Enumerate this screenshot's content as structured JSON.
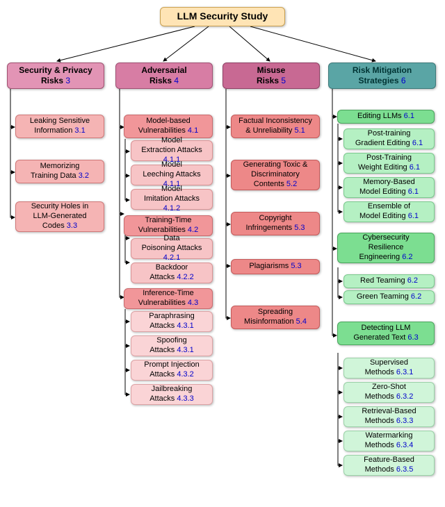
{
  "root": {
    "title": "LLM Security Study"
  },
  "cats": {
    "sec": {
      "label": "Security & Privacy\nRisks",
      "ref": "3"
    },
    "adv": {
      "label": "Adversarial\nRisks",
      "ref": "4"
    },
    "mis": {
      "label": "Misuse\nRisks",
      "ref": "5"
    },
    "mit": {
      "label": "Risk Mitigation\nStrategies",
      "ref": "6"
    }
  },
  "sec_items": {
    "a": {
      "label": "Leaking Sensitive\nInformation",
      "ref": "3.1"
    },
    "b": {
      "label": "Memorizing\nTraining Data",
      "ref": "3.2"
    },
    "c": {
      "label": "Security Holes in\nLLM-Generated\nCodes",
      "ref": "3.3"
    }
  },
  "adv_items": {
    "mbv": {
      "label": "Model-based\nVulnerabilities",
      "ref": "4.1"
    },
    "mea": {
      "label": "Model\nExtraction Attacks",
      "ref": "4.1.1"
    },
    "mla": {
      "label": "Model\nLeeching Attacks",
      "ref": "4.1.1"
    },
    "mia": {
      "label": "Model\nImitation Attacks",
      "ref": "4.1.2"
    },
    "ttv": {
      "label": "Training-Time\nVulnerabilities",
      "ref": "4.2"
    },
    "dpa": {
      "label": "Data\nPoisoning Attacks",
      "ref": "4.2.1"
    },
    "bda": {
      "label": "Backdoor\nAttacks",
      "ref": "4.2.2"
    },
    "itv": {
      "label": "Inference-Time\nVulnerabilities",
      "ref": "4.3"
    },
    "par": {
      "label": "Paraphrasing\nAttacks",
      "ref": "4.3.1"
    },
    "spo": {
      "label": "Spoofing\nAttacks",
      "ref": "4.3.1"
    },
    "pia": {
      "label": "Prompt Injection\nAttacks",
      "ref": "4.3.2"
    },
    "jba": {
      "label": "Jailbreaking\nAttacks",
      "ref": "4.3.3"
    }
  },
  "mis_items": {
    "fi": {
      "label": "Factual Inconsistency\n& Unreliability",
      "ref": "5.1"
    },
    "tx": {
      "label": "Generating Toxic &\nDiscriminatory\nContents",
      "ref": "5.2"
    },
    "cp": {
      "label": "Copyright\nInfringements",
      "ref": "5.3"
    },
    "pl": {
      "label": "Plagiarisms",
      "ref": "5.3"
    },
    "sm": {
      "label": "Spreading\nMisinformation",
      "ref": "5.4"
    }
  },
  "mit_items": {
    "ed": {
      "label": "Editing LLMs",
      "ref": "6.1"
    },
    "pge": {
      "label": "Post-training\nGradient Editing",
      "ref": "6.1"
    },
    "pwe": {
      "label": "Post-Training\nWeight Editing",
      "ref": "6.1"
    },
    "mbe": {
      "label": "Memory-Based\nModel Editing",
      "ref": "6.1"
    },
    "eme": {
      "label": "Ensemble of\nModel Editing",
      "ref": "6.1"
    },
    "cre": {
      "label": "Cybersecurity\nResilience\nEngineering",
      "ref": "6.2"
    },
    "rt": {
      "label": "Red Teaming",
      "ref": "6.2"
    },
    "gt": {
      "label": "Green Teaming",
      "ref": "6.2"
    },
    "dgt": {
      "label": "Detecting LLM\nGenerated Text",
      "ref": "6.3"
    },
    "sup": {
      "label": "Supervised\nMethods",
      "ref": "6.3.1"
    },
    "zs": {
      "label": "Zero-Shot\nMethods",
      "ref": "6.3.2"
    },
    "rb": {
      "label": "Retrieval-Based\nMethods",
      "ref": "6.3.3"
    },
    "wm": {
      "label": "Watermarking\nMethods",
      "ref": "6.3.4"
    },
    "fb": {
      "label": "Feature-Based\nMethods",
      "ref": "6.3.5"
    }
  },
  "chart_data": {
    "type": "tree",
    "title": "LLM Security Study",
    "nodes": [
      {
        "id": "root",
        "label": "LLM Security Study"
      },
      {
        "id": "sec",
        "label": "Security & Privacy Risks",
        "ref": "3",
        "parent": "root"
      },
      {
        "id": "adv",
        "label": "Adversarial Risks",
        "ref": "4",
        "parent": "root"
      },
      {
        "id": "mis",
        "label": "Misuse Risks",
        "ref": "5",
        "parent": "root"
      },
      {
        "id": "mit",
        "label": "Risk Mitigation Strategies",
        "ref": "6",
        "parent": "root"
      },
      {
        "id": "sec.a",
        "label": "Leaking Sensitive Information",
        "ref": "3.1",
        "parent": "sec"
      },
      {
        "id": "sec.b",
        "label": "Memorizing Training Data",
        "ref": "3.2",
        "parent": "sec"
      },
      {
        "id": "sec.c",
        "label": "Security Holes in LLM-Generated Codes",
        "ref": "3.3",
        "parent": "sec"
      },
      {
        "id": "adv.mbv",
        "label": "Model-based Vulnerabilities",
        "ref": "4.1",
        "parent": "adv"
      },
      {
        "id": "adv.mea",
        "label": "Model Extraction Attacks",
        "ref": "4.1.1",
        "parent": "adv.mbv"
      },
      {
        "id": "adv.mla",
        "label": "Model Leeching Attacks",
        "ref": "4.1.1",
        "parent": "adv.mbv"
      },
      {
        "id": "adv.mia",
        "label": "Model Imitation Attacks",
        "ref": "4.1.2",
        "parent": "adv.mbv"
      },
      {
        "id": "adv.ttv",
        "label": "Training-Time Vulnerabilities",
        "ref": "4.2",
        "parent": "adv"
      },
      {
        "id": "adv.dpa",
        "label": "Data Poisoning Attacks",
        "ref": "4.2.1",
        "parent": "adv.ttv"
      },
      {
        "id": "adv.bda",
        "label": "Backdoor Attacks",
        "ref": "4.2.2",
        "parent": "adv.ttv"
      },
      {
        "id": "adv.itv",
        "label": "Inference-Time Vulnerabilities",
        "ref": "4.3",
        "parent": "adv"
      },
      {
        "id": "adv.par",
        "label": "Paraphrasing Attacks",
        "ref": "4.3.1",
        "parent": "adv.itv"
      },
      {
        "id": "adv.spo",
        "label": "Spoofing Attacks",
        "ref": "4.3.1",
        "parent": "adv.itv"
      },
      {
        "id": "adv.pia",
        "label": "Prompt Injection Attacks",
        "ref": "4.3.2",
        "parent": "adv.itv"
      },
      {
        "id": "adv.jba",
        "label": "Jailbreaking Attacks",
        "ref": "4.3.3",
        "parent": "adv.itv"
      },
      {
        "id": "mis.fi",
        "label": "Factual Inconsistency & Unreliability",
        "ref": "5.1",
        "parent": "mis"
      },
      {
        "id": "mis.tx",
        "label": "Generating Toxic & Discriminatory Contents",
        "ref": "5.2",
        "parent": "mis"
      },
      {
        "id": "mis.cp",
        "label": "Copyright Infringements",
        "ref": "5.3",
        "parent": "mis"
      },
      {
        "id": "mis.pl",
        "label": "Plagiarisms",
        "ref": "5.3",
        "parent": "mis"
      },
      {
        "id": "mis.sm",
        "label": "Spreading Misinformation",
        "ref": "5.4",
        "parent": "mis"
      },
      {
        "id": "mit.ed",
        "label": "Editing LLMs",
        "ref": "6.1",
        "parent": "mit"
      },
      {
        "id": "mit.pge",
        "label": "Post-training Gradient Editing",
        "ref": "6.1",
        "parent": "mit.ed"
      },
      {
        "id": "mit.pwe",
        "label": "Post-Training Weight Editing",
        "ref": "6.1",
        "parent": "mit.ed"
      },
      {
        "id": "mit.mbe",
        "label": "Memory-Based Model Editing",
        "ref": "6.1",
        "parent": "mit.ed"
      },
      {
        "id": "mit.eme",
        "label": "Ensemble of Model Editing",
        "ref": "6.1",
        "parent": "mit.ed"
      },
      {
        "id": "mit.cre",
        "label": "Cybersecurity Resilience Engineering",
        "ref": "6.2",
        "parent": "mit"
      },
      {
        "id": "mit.rt",
        "label": "Red Teaming",
        "ref": "6.2",
        "parent": "mit.cre"
      },
      {
        "id": "mit.gt",
        "label": "Green Teaming",
        "ref": "6.2",
        "parent": "mit.cre"
      },
      {
        "id": "mit.dgt",
        "label": "Detecting LLM Generated Text",
        "ref": "6.3",
        "parent": "mit"
      },
      {
        "id": "mit.sup",
        "label": "Supervised Methods",
        "ref": "6.3.1",
        "parent": "mit.dgt"
      },
      {
        "id": "mit.zs",
        "label": "Zero-Shot Methods",
        "ref": "6.3.2",
        "parent": "mit.dgt"
      },
      {
        "id": "mit.rb",
        "label": "Retrieval-Based Methods",
        "ref": "6.3.3",
        "parent": "mit.dgt"
      },
      {
        "id": "mit.wm",
        "label": "Watermarking Methods",
        "ref": "6.3.4",
        "parent": "mit.dgt"
      },
      {
        "id": "mit.fb",
        "label": "Feature-Based Methods",
        "ref": "6.3.5",
        "parent": "mit.dgt"
      }
    ]
  }
}
